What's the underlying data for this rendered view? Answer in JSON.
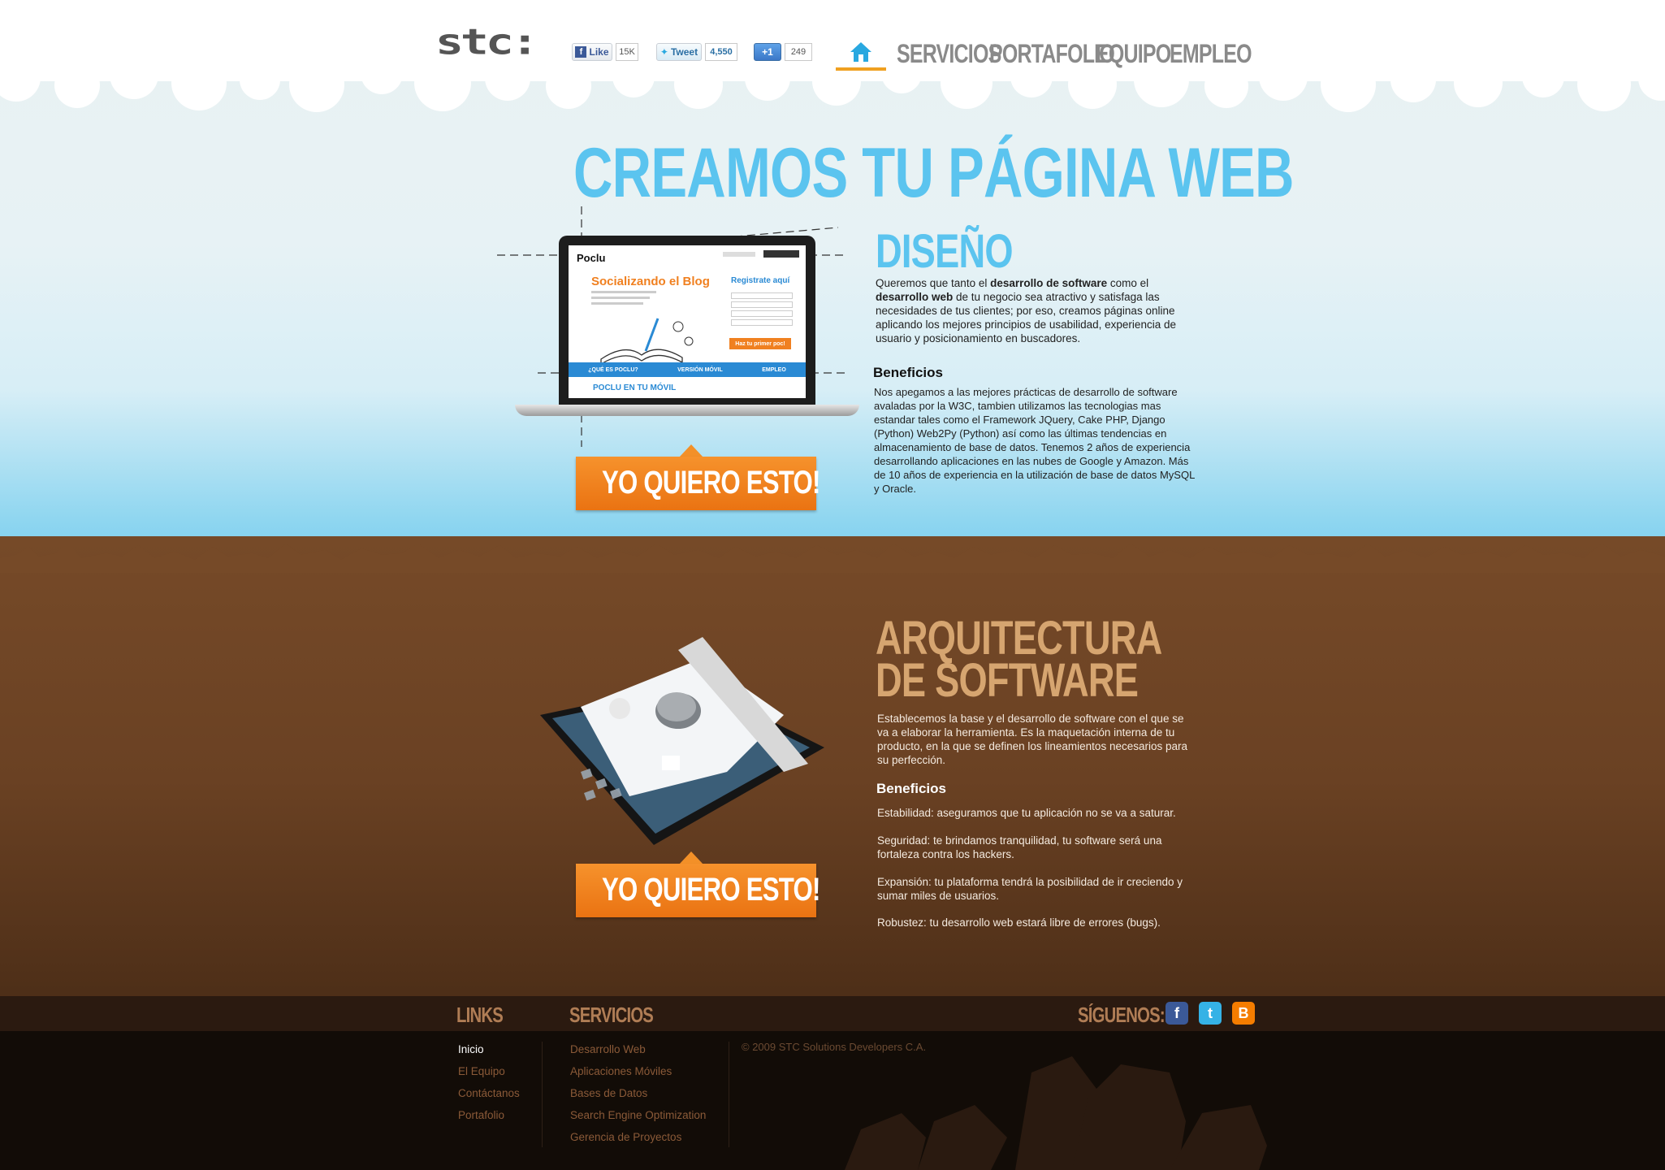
{
  "header": {
    "logo": "stc:",
    "facebook": {
      "label": "Like",
      "count": "15K"
    },
    "twitter": {
      "label": "Tweet",
      "count": "4,550"
    },
    "gplus": {
      "label": "+1",
      "count": "249"
    },
    "nav": [
      "SERVICIOS",
      "PORTAFOLIO",
      "EQUIPO",
      "EMPLEO"
    ],
    "home_icon": "home-icon"
  },
  "hero": {
    "title": "CREAMOS TU PÁGINA WEB"
  },
  "laptop_screen": {
    "brand": "Poclu",
    "headline": "Socializando el Blog",
    "register": "Registrate aquí",
    "cta": "Haz tu primer poc!",
    "nav": [
      "¿QUÉ ES POCLU?",
      "VERSIÓN MÓVIL",
      "EMPLEO"
    ],
    "mobile": "POCLU EN TU MÓVIL"
  },
  "diseno": {
    "title": "DISEÑO",
    "intro_parts": [
      "Queremos que tanto el ",
      "desarrollo de software",
      " como el ",
      "desarrollo web",
      " de tu negocio sea atractivo y satisfaga las necesidades de tus clientes; por eso, creamos páginas online aplicando los mejores principios de usabilidad, experiencia de usuario y posicionamiento en buscadores."
    ],
    "benefits_title": "Beneficios",
    "benefits_text": "Nos apegamos a las mejores prácticas de desarrollo de software avaladas por la W3C, tambien utilizamos las tecnologias mas estandar tales como el Framework JQuery, Cake PHP, Django (Python) Web2Py (Python) así como las últimas tendencias en almacenamiento de base de datos. Tenemos 2 años de experiencia desarrollando aplicaciones en las nubes de Google y Amazon. Más de 10 años de experiencia en la utilización de base de datos MySQL y Oracle.",
    "cta": "YO QUIERO ESTO!"
  },
  "arquitectura": {
    "title_line1": "ARQUITECTURA",
    "title_line2": "DE SOFTWARE",
    "intro": "Establecemos la base y el desarrollo de software con el que se va a elaborar la herramienta. Es la maquetación interna de tu producto, en la que se definen los lineamientos necesarios para su perfección.",
    "benefits_title": "Beneficios",
    "benefits": [
      "Estabilidad: aseguramos que tu aplicación no se va a saturar.",
      "Seguridad: te brindamos tranquilidad, tu software será una fortaleza contra los hackers.",
      "Expansión: tu plataforma tendrá la posibilidad de ir creciendo y sumar miles de usuarios.",
      "Robustez: tu desarrollo web estará libre de errores (bugs)."
    ],
    "cta": "YO QUIERO ESTO!"
  },
  "footer": {
    "links_title": "LINKS",
    "links": [
      "Inicio",
      "El Equipo",
      "Contáctanos",
      "Portafolio"
    ],
    "services_title": "SERVICIOS",
    "services": [
      "Desarrollo Web",
      "Aplicaciones Móviles",
      "Bases de Datos",
      "Search Engine Optimization",
      "Gerencia de Proyectos"
    ],
    "copyright": "© 2009 STC Solutions Developers C.A.",
    "follow_title": "SÍGUENOS:",
    "social_icons": [
      "facebook-icon",
      "twitter-icon",
      "blogger-icon"
    ]
  },
  "colors": {
    "accent_blue": "#5bc4ef",
    "cta_orange": "#f08020",
    "brown_title": "#d6a570",
    "earth": "#6a4123"
  }
}
